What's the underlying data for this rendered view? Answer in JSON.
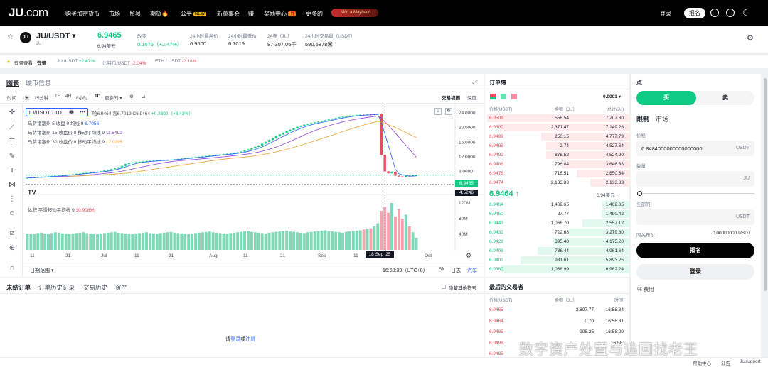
{
  "nav": {
    "logo_main": "JU",
    "logo_suffix": ".com",
    "items": [
      "购买加密货币",
      "市场",
      "贸易",
      "期货🔥",
      "公平",
      "新董事会",
      "赚",
      "奖励中心",
      "更多的"
    ],
    "new_badge": "NEW",
    "reward_badge": "🎁",
    "promo_text": "Win a Maybach",
    "login": "登录",
    "signup": "报名"
  },
  "ticker": {
    "pair": "JU/USDT",
    "base": "JU",
    "price": "6.9465",
    "price_usd": "6.94美元",
    "change_label": "改变",
    "change_value": "0.1675（+2.47%）",
    "high_label": "24小时最高价",
    "high_value": "6.9500",
    "low_label": "24小时最低价",
    "low_value": "6.7019",
    "vol_base_label": "24卷（JU）",
    "vol_base_value": "87,307.06千",
    "vol_quote_label": "24小时交易量（USDT）",
    "vol_quote_value": "590.6878米"
  },
  "subbar": {
    "login_note": "登录查看",
    "login_link": "登录",
    "pairs": [
      {
        "name": "JU /USDT",
        "change": "+2.47%",
        "up": true
      },
      {
        "name": "比特币/USDT",
        "change": "-2.04%",
        "up": false
      },
      {
        "name": "ETH / USDT",
        "change": "-2.18%",
        "up": false
      }
    ]
  },
  "chart_panel": {
    "tab_chart": "图表",
    "tab_info": "硬币信息",
    "timeframes": [
      "时间",
      "1米",
      "15分钟",
      "1H",
      "4H",
      "8小时",
      "1D",
      "更多的"
    ],
    "active_timeframe": "1D",
    "view_trade": "交易视图",
    "view_depth": "深度",
    "legend_title": "JU/USDT · 1D",
    "legend_ohlc_o": "哈6.9464",
    "legend_ohlc_h": "高6.7019",
    "legend_ohlc_c": "C6.9464",
    "legend_ohlc_chg": "+0.2302（+3.43%）",
    "ma5": "马萨诸塞州 5 收盘 0 均线 9",
    "ma5_val": "6.7056",
    "ma15": "马萨诸塞州 15 收盘价 0 移动平均线 9",
    "ma15_val": "11.5492",
    "ma30": "马萨诸塞州 30 收盘价 0 移动平均线 9",
    "ma30_val": "17.0395",
    "vol_label": "体积  平滑移动平均线 9",
    "vol_val": "30.908米",
    "date_range": "日期范围",
    "time_readout": "16:58:39（UTC+8）",
    "pct": "%",
    "log": "日志",
    "auto": "汽车",
    "crosshair_date": "18 Sep '25",
    "price_tag": "6.9465",
    "cross_tag": "4.5246"
  },
  "chart_data": {
    "type": "candlestick",
    "y_ticks": [
      "24.0000",
      "20.0000",
      "16.0000",
      "12.0000",
      "8.0000"
    ],
    "vol_ticks": [
      "120M",
      "80M",
      "40M"
    ],
    "x_ticks": [
      "11",
      "21",
      "Jul",
      "11",
      "21",
      "Aug",
      "11",
      "21",
      "Sep",
      "11",
      "Oct"
    ],
    "ylim": [
      4,
      25
    ],
    "closes": [
      6.2,
      6.3,
      6.35,
      6.45,
      6.5,
      6.55,
      6.6,
      6.7,
      6.8,
      6.85,
      6.9,
      7.0,
      7.1,
      7.2,
      7.3,
      7.4,
      7.5,
      7.6,
      7.7,
      7.8,
      7.9,
      8.0,
      8.2,
      8.4,
      8.6,
      8.8,
      9.1,
      9.5,
      10.0,
      10.3,
      10.4,
      10.5,
      10.6,
      10.7,
      10.8,
      10.85,
      10.9,
      11.0,
      11.05,
      11.1,
      11.15,
      11.2,
      11.3,
      11.4,
      11.5,
      11.6,
      11.7,
      11.8,
      11.9,
      12.0,
      12.1,
      12.2,
      12.3,
      12.4,
      12.5,
      12.6,
      12.7,
      12.8,
      12.9,
      13.0,
      13.2,
      13.4,
      13.7,
      14.0,
      14.3,
      14.7,
      15.1,
      15.6,
      16.1,
      16.6,
      17.1,
      17.6,
      18.1,
      18.6,
      19.0,
      19.4,
      19.8,
      20.2,
      20.5,
      20.8,
      21.0,
      21.2,
      21.4,
      21.6,
      21.8,
      22.0,
      22.2,
      22.4,
      22.6,
      22.8,
      23.0,
      23.1,
      23.2,
      23.3,
      23.4,
      23.5,
      23.4,
      23.6,
      23.5,
      23.7,
      23.8,
      12.5,
      8.0,
      7.5,
      7.9,
      6.8,
      6.6,
      6.5,
      6.8,
      6.7,
      6.9,
      6.95
    ],
    "volumes": [
      42,
      40,
      41,
      43,
      44,
      42,
      41,
      43,
      45,
      44,
      42,
      41,
      40,
      42,
      43,
      44,
      45,
      43,
      42,
      41,
      40,
      42,
      43,
      44,
      45,
      46,
      44,
      43,
      42,
      41,
      40,
      42,
      43,
      44,
      45,
      43,
      42,
      41,
      43,
      44,
      45,
      46,
      44,
      43,
      42,
      41,
      40,
      42,
      43,
      44,
      45,
      46,
      47,
      45,
      44,
      43,
      42,
      41,
      43,
      44,
      45,
      46,
      47,
      48,
      46,
      45,
      44,
      43,
      42,
      44,
      45,
      46,
      47,
      48,
      49,
      47,
      46,
      45,
      44,
      43,
      45,
      46,
      47,
      48,
      49,
      50,
      48,
      47,
      46,
      45,
      44,
      46,
      47,
      48,
      49,
      50,
      52,
      54,
      55,
      60,
      68,
      100,
      110,
      95,
      120,
      85,
      105,
      80,
      90,
      60,
      45,
      30.9
    ]
  },
  "orderbook": {
    "title": "订单簿",
    "precision": "0.0001",
    "col_price": "价格(USDT)",
    "col_amount": "金额（JU）",
    "col_total": "总计(JU)",
    "asks": [
      [
        "6.9506",
        "558.54",
        "7,707.80"
      ],
      [
        "6.9500",
        "2,371.47",
        "7,149.26"
      ],
      [
        "6.9499",
        "250.15",
        "4,777.79"
      ],
      [
        "6.9498",
        "2.74",
        "4,527.64"
      ],
      [
        "6.9492",
        "878.52",
        "4,524.90"
      ],
      [
        "6.9486",
        "796.04",
        "3,646.38"
      ],
      [
        "6.9478",
        "716.51",
        "2,850.34"
      ],
      [
        "6.9474",
        "2,133.83",
        "2,133.83"
      ]
    ],
    "mid_price": "6.9464 ↑",
    "mid_usd": "6.94美元",
    "bids": [
      [
        "6.9464",
        "1,462.65",
        "1,462.65"
      ],
      [
        "6.9450",
        "27.77",
        "1,490.42"
      ],
      [
        "6.9443",
        "1,066.70",
        "2,557.12"
      ],
      [
        "6.9432",
        "722.68",
        "3,279.80"
      ],
      [
        "6.9422",
        "895.40",
        "4,175.20"
      ],
      [
        "6.9408",
        "786.44",
        "4,961.64"
      ],
      [
        "6.9401",
        "931.61",
        "5,893.25"
      ],
      [
        "6.9380",
        "1,068.99",
        "6,962.24"
      ]
    ]
  },
  "trade": {
    "title": "点",
    "buy": "买",
    "sell": "卖",
    "tab_limit": "限制",
    "tab_market": "市场",
    "price_label": "价格",
    "price_value": "6.8484000000000000000",
    "price_unit": "USDT",
    "qty_label": "数量",
    "qty_unit": "JU",
    "total_label": "全部的",
    "total_unit": "USDT",
    "fee_label": "同关布尔",
    "fee_value": "0.00000000",
    "fee_unit": "USDT",
    "signup_btn": "报名",
    "login_btn": "登录",
    "fee_link": "% 费用"
  },
  "orders": {
    "tabs": [
      "未结订单",
      "订单历史记录",
      "交易历史",
      "资产"
    ],
    "hide_others": "隐藏其他符号",
    "prompt_prefix": "请",
    "prompt_login": "登录",
    "prompt_or": "或",
    "prompt_signup": "注册"
  },
  "trades": {
    "title": "最后的交易者",
    "col_price": "价格(USDT)",
    "col_amount": "金额（JU）",
    "col_time": "时间",
    "rows": [
      [
        "6.9465",
        "3,807.77",
        "16:58:34"
      ],
      [
        "6.9464",
        "0.70",
        "16:58:31"
      ],
      [
        "6.9485",
        "908.25",
        "16:58:29"
      ],
      [
        "6.9498",
        "",
        "16:58:"
      ],
      [
        "6.9485",
        "",
        ""
      ]
    ]
  },
  "footer": {
    "help": "帮助中心",
    "announce": "公告",
    "support": "JUsupport"
  },
  "watermark": "数字资产处置与追回找老王",
  "colors": {
    "green": "#0ecb81",
    "red": "#f6465d",
    "purple": "#8e44d6",
    "orange": "#f0a030",
    "blue": "#2962ff"
  }
}
